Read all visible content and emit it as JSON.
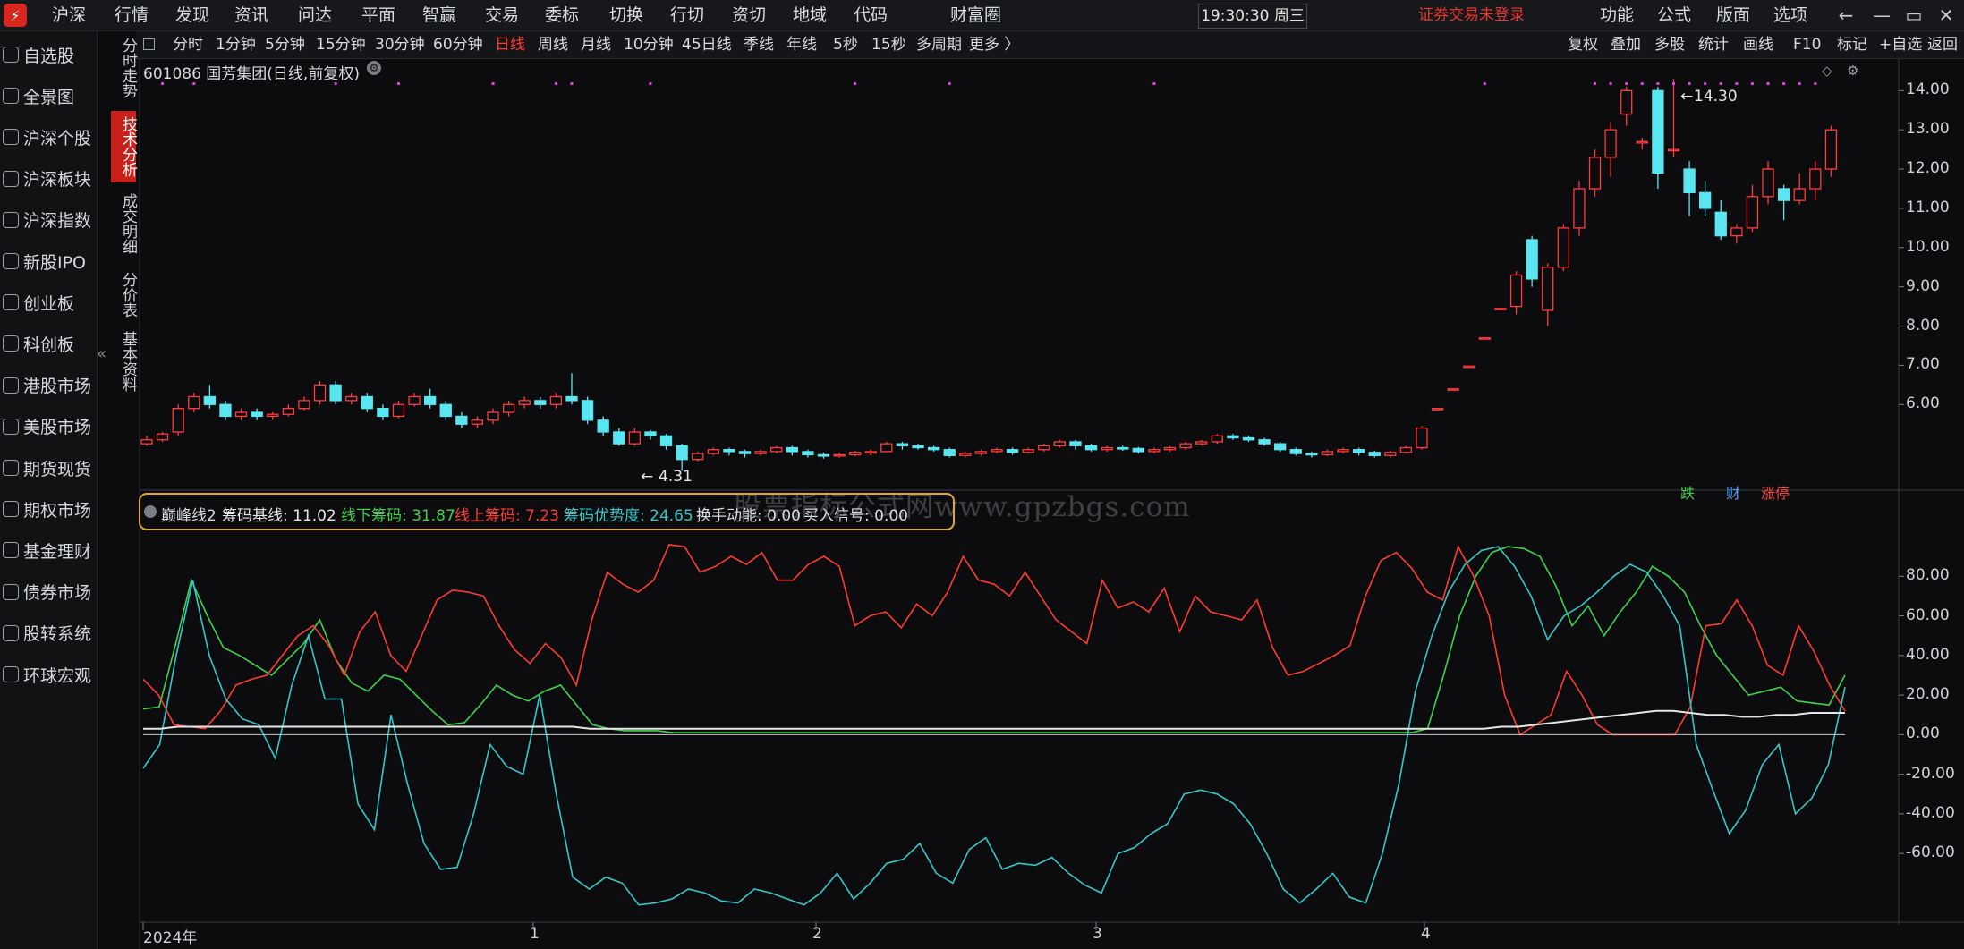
{
  "menu": [
    "沪深",
    "行情",
    "发现",
    "资讯",
    "问达",
    "平面",
    "智赢",
    "交易",
    "委标",
    "切换",
    "行切",
    "资切",
    "地域",
    "代码",
    "财富圈"
  ],
  "clock": "19:30:30 周三",
  "notice": "证券交易未登录",
  "right_menu": [
    "功能",
    "公式",
    "版面",
    "选项"
  ],
  "window_buttons": [
    "←",
    "—",
    "▭",
    "✕"
  ],
  "sidebar": [
    "自选股",
    "全景图",
    "沪深个股",
    "沪深板块",
    "沪深指数",
    "新股IPO",
    "创业板",
    "科创板",
    "港股市场",
    "美股市场",
    "期货现货",
    "期权市场",
    "基金理财",
    "债券市场",
    "股转系统",
    "环球宏观"
  ],
  "vtabs": [
    "分时走势",
    "技术分析",
    "成交明细",
    "分价表",
    "基本资料"
  ],
  "periods": [
    "分时",
    "1分钟",
    "5分钟",
    "15分钟",
    "30分钟",
    "60分钟",
    "日线",
    "周线",
    "月线",
    "10分钟",
    "45日线",
    "季线",
    "年线",
    "5秒",
    "15秒",
    "多周期",
    "更多 〉"
  ],
  "active_period": "日线",
  "tools": [
    "复权",
    "叠加",
    "多股",
    "统计",
    "画线",
    "F10",
    "标记",
    "+自选",
    "返回"
  ],
  "stock_title": "601086 国芳集团(日线,前复权)",
  "price_high_label": "14.30",
  "price_low_label": "4.31",
  "tags": {
    "die": "跌",
    "cai": "财",
    "zhangting": "涨停",
    "die_color": "#3cd24c",
    "cai_color": "#4aa3ff",
    "zhangting_color": "#ff4040"
  },
  "indicator_legend": [
    {
      "text": "巅峰线2",
      "color": "#d8dbe0"
    },
    {
      "text": "筹码基线: 11.02",
      "color": "#e6e6e6"
    },
    {
      "text": "线下筹码: 31.87",
      "color": "#3cd24c"
    },
    {
      "text": "线上筹码: 7.23",
      "color": "#ff3b30"
    },
    {
      "text": "筹码优势度: 24.65",
      "color": "#32c8c8"
    },
    {
      "text": "换手动能: 0.00",
      "color": "#d8dbe0"
    },
    {
      "text": "买入信号: 0.00",
      "color": "#d8dbe0"
    }
  ],
  "watermark": "股票指标公式网www.gpzbgs.com",
  "x_labels": [
    "2024年",
    "1",
    "2",
    "3",
    "4"
  ],
  "colors": {
    "up": "#ff3b3b",
    "down": "#5ae6f0",
    "accent": "#e1a82a"
  },
  "chart_data": [
    {
      "type": "candlestick",
      "title": "601086 国芳集团(日线,前复权)",
      "y_ticks": [
        6.0,
        7.0,
        8.0,
        9.0,
        10.0,
        11.0,
        12.0,
        13.0,
        14.0
      ],
      "ylim": [
        4.0,
        14.6
      ],
      "candles": [
        [
          5.0,
          5.1,
          4.95,
          5.2
        ],
        [
          5.1,
          5.25,
          5.05,
          5.3
        ],
        [
          5.3,
          5.9,
          5.2,
          6.0
        ],
        [
          5.9,
          6.2,
          5.8,
          6.3
        ],
        [
          6.2,
          6.0,
          5.9,
          6.5
        ],
        [
          6.0,
          5.7,
          5.6,
          6.1
        ],
        [
          5.7,
          5.8,
          5.6,
          5.9
        ],
        [
          5.8,
          5.7,
          5.6,
          5.9
        ],
        [
          5.7,
          5.75,
          5.6,
          5.8
        ],
        [
          5.75,
          5.9,
          5.7,
          6.0
        ],
        [
          5.9,
          6.1,
          5.85,
          6.2
        ],
        [
          6.1,
          6.5,
          6.0,
          6.6
        ],
        [
          6.5,
          6.1,
          6.0,
          6.6
        ],
        [
          6.1,
          6.2,
          6.0,
          6.3
        ],
        [
          6.2,
          5.9,
          5.8,
          6.3
        ],
        [
          5.9,
          5.7,
          5.6,
          6.0
        ],
        [
          5.7,
          6.0,
          5.65,
          6.1
        ],
        [
          6.0,
          6.2,
          5.95,
          6.3
        ],
        [
          6.2,
          6.0,
          5.9,
          6.4
        ],
        [
          6.0,
          5.7,
          5.6,
          6.1
        ],
        [
          5.7,
          5.5,
          5.4,
          5.8
        ],
        [
          5.5,
          5.6,
          5.4,
          5.7
        ],
        [
          5.6,
          5.8,
          5.5,
          5.9
        ],
        [
          5.8,
          6.0,
          5.7,
          6.1
        ],
        [
          6.0,
          6.1,
          5.9,
          6.2
        ],
        [
          6.1,
          6.0,
          5.9,
          6.2
        ],
        [
          6.0,
          6.2,
          5.9,
          6.3
        ],
        [
          6.2,
          6.1,
          6.0,
          6.8
        ],
        [
          6.1,
          5.6,
          5.5,
          6.2
        ],
        [
          5.6,
          5.3,
          5.2,
          5.7
        ],
        [
          5.3,
          5.0,
          4.95,
          5.4
        ],
        [
          5.0,
          5.3,
          4.95,
          5.4
        ],
        [
          5.3,
          5.2,
          5.1,
          5.35
        ],
        [
          5.2,
          4.95,
          4.85,
          5.25
        ],
        [
          4.95,
          4.6,
          4.31,
          5.0
        ],
        [
          4.6,
          4.75,
          4.55,
          4.8
        ],
        [
          4.75,
          4.85,
          4.7,
          4.9
        ],
        [
          4.85,
          4.8,
          4.7,
          4.9
        ],
        [
          4.8,
          4.75,
          4.65,
          4.85
        ],
        [
          4.75,
          4.8,
          4.7,
          4.85
        ],
        [
          4.8,
          4.9,
          4.75,
          4.95
        ],
        [
          4.9,
          4.8,
          4.7,
          4.95
        ],
        [
          4.8,
          4.72,
          4.65,
          4.85
        ],
        [
          4.72,
          4.7,
          4.62,
          4.78
        ],
        [
          4.7,
          4.72,
          4.65,
          4.78
        ],
        [
          4.72,
          4.78,
          4.68,
          4.82
        ],
        [
          4.78,
          4.8,
          4.7,
          4.85
        ],
        [
          4.8,
          5.0,
          4.78,
          5.05
        ],
        [
          5.0,
          4.95,
          4.85,
          5.05
        ],
        [
          4.95,
          4.9,
          4.85,
          5.0
        ],
        [
          4.9,
          4.85,
          4.8,
          4.95
        ],
        [
          4.85,
          4.7,
          4.65,
          4.9
        ],
        [
          4.7,
          4.75,
          4.65,
          4.8
        ],
        [
          4.75,
          4.8,
          4.7,
          4.85
        ],
        [
          4.8,
          4.85,
          4.75,
          4.9
        ],
        [
          4.85,
          4.78,
          4.72,
          4.9
        ],
        [
          4.78,
          4.85,
          4.75,
          4.9
        ],
        [
          4.85,
          4.95,
          4.8,
          5.0
        ],
        [
          4.95,
          5.05,
          4.9,
          5.1
        ],
        [
          5.05,
          4.95,
          4.85,
          5.1
        ],
        [
          4.95,
          4.85,
          4.8,
          5.0
        ],
        [
          4.85,
          4.9,
          4.8,
          4.95
        ],
        [
          4.9,
          4.88,
          4.82,
          4.95
        ],
        [
          4.88,
          4.8,
          4.75,
          4.92
        ],
        [
          4.8,
          4.85,
          4.75,
          4.9
        ],
        [
          4.85,
          4.9,
          4.8,
          4.95
        ],
        [
          4.9,
          5.0,
          4.85,
          5.05
        ],
        [
          5.0,
          5.05,
          4.95,
          5.1
        ],
        [
          5.05,
          5.2,
          5.0,
          5.25
        ],
        [
          5.2,
          5.15,
          5.1,
          5.25
        ],
        [
          5.15,
          5.1,
          5.05,
          5.2
        ],
        [
          5.1,
          5.0,
          4.95,
          5.15
        ],
        [
          5.0,
          4.85,
          4.8,
          5.05
        ],
        [
          4.85,
          4.75,
          4.7,
          4.9
        ],
        [
          4.75,
          4.72,
          4.65,
          4.8
        ],
        [
          4.72,
          4.8,
          4.68,
          4.85
        ],
        [
          4.8,
          4.85,
          4.75,
          4.9
        ],
        [
          4.85,
          4.78,
          4.7,
          4.9
        ],
        [
          4.78,
          4.7,
          4.65,
          4.82
        ],
        [
          4.7,
          4.78,
          4.65,
          4.82
        ],
        [
          4.78,
          4.9,
          4.75,
          4.95
        ],
        [
          4.9,
          5.4,
          4.85,
          5.45
        ],
        [
          5.9,
          5.9,
          5.9,
          5.9
        ],
        [
          6.4,
          6.4,
          6.4,
          6.4
        ],
        [
          6.98,
          6.98,
          6.98,
          6.98
        ],
        [
          7.7,
          7.7,
          7.7,
          7.7
        ],
        [
          8.45,
          8.45,
          8.45,
          8.45
        ],
        [
          8.5,
          9.3,
          8.3,
          9.4
        ],
        [
          10.2,
          9.2,
          9.0,
          10.3
        ],
        [
          8.4,
          9.5,
          8.0,
          9.6
        ],
        [
          9.5,
          10.5,
          9.4,
          10.6
        ],
        [
          10.5,
          11.5,
          10.3,
          11.7
        ],
        [
          11.5,
          12.3,
          11.3,
          12.5
        ],
        [
          12.3,
          13.0,
          11.8,
          13.2
        ],
        [
          13.4,
          14.0,
          13.1,
          14.1
        ],
        [
          12.7,
          12.7,
          12.5,
          12.8
        ],
        [
          14.0,
          11.9,
          11.5,
          14.1
        ],
        [
          12.5,
          12.5,
          12.3,
          14.3
        ],
        [
          12.0,
          11.4,
          10.8,
          12.2
        ],
        [
          11.4,
          11.0,
          10.8,
          11.7
        ],
        [
          10.9,
          10.3,
          10.2,
          11.2
        ],
        [
          10.3,
          10.5,
          10.1,
          10.6
        ],
        [
          10.5,
          11.3,
          10.4,
          11.6
        ],
        [
          11.3,
          12.0,
          11.1,
          12.2
        ],
        [
          11.5,
          11.2,
          10.7,
          11.6
        ],
        [
          11.2,
          11.5,
          11.1,
          11.9
        ],
        [
          11.5,
          12.0,
          11.2,
          12.2
        ],
        [
          12.0,
          13.0,
          11.8,
          13.1
        ]
      ]
    },
    {
      "type": "line",
      "title": "巅峰线2",
      "y_ticks": [
        -60.0,
        -40.0,
        -20.0,
        0.0,
        20.0,
        40.0,
        60.0,
        80.0
      ],
      "ylim": [
        -92,
        100
      ],
      "series": [
        {
          "name": "线下筹码",
          "color": "#3cd24c",
          "values": [
            13,
            14,
            45,
            78,
            60,
            44,
            40,
            35,
            30,
            38,
            46,
            58,
            38,
            26,
            22,
            30,
            28,
            20,
            12,
            5,
            6,
            15,
            25,
            20,
            17,
            22,
            25,
            15,
            5,
            3,
            2,
            2,
            2,
            1,
            1,
            1,
            1,
            1,
            1,
            1,
            1,
            1,
            1,
            1,
            1,
            1,
            1,
            1,
            1,
            1,
            1,
            1,
            1,
            1,
            1,
            1,
            1,
            1,
            1,
            1,
            1,
            1,
            1,
            1,
            1,
            1,
            1,
            1,
            1,
            1,
            1,
            1,
            1,
            1,
            1,
            1,
            1,
            1,
            1,
            1,
            3,
            30,
            60,
            80,
            92,
            95,
            94,
            90,
            75,
            55,
            65,
            50,
            62,
            72,
            85,
            80,
            72,
            55,
            40,
            30,
            20,
            22,
            24,
            17,
            16,
            15,
            30
          ]
        },
        {
          "name": "线上筹码",
          "color": "#ff3b30",
          "values": [
            28,
            20,
            5,
            4,
            3,
            12,
            25,
            28,
            30,
            40,
            50,
            55,
            45,
            30,
            52,
            62,
            40,
            32,
            50,
            68,
            73,
            72,
            70,
            55,
            43,
            36,
            46,
            39,
            25,
            58,
            82,
            76,
            72,
            78,
            96,
            95,
            82,
            85,
            90,
            86,
            92,
            78,
            78,
            86,
            90,
            85,
            55,
            60,
            62,
            54,
            66,
            60,
            72,
            90,
            78,
            76,
            70,
            82,
            70,
            58,
            52,
            46,
            78,
            64,
            67,
            62,
            74,
            52,
            70,
            62,
            60,
            58,
            68,
            44,
            30,
            32,
            36,
            40,
            45,
            70,
            88,
            92,
            84,
            72,
            68,
            95,
            80,
            60,
            20,
            0,
            5,
            10,
            32,
            20,
            5,
            0,
            0,
            0,
            0,
            0,
            14,
            55,
            56,
            68,
            55,
            35,
            30,
            55,
            42,
            25,
            12
          ]
        },
        {
          "name": "筹码优势度",
          "color": "#32c8c8",
          "values": [
            -17,
            -5,
            40,
            78,
            40,
            18,
            8,
            5,
            -12,
            25,
            50,
            18,
            18,
            -35,
            -48,
            10,
            -25,
            -55,
            -68,
            -67,
            -40,
            -5,
            -16,
            -20,
            20,
            -30,
            -72,
            -78,
            -72,
            -75,
            -86,
            -85,
            -83,
            -78,
            -80,
            -84,
            -85,
            -78,
            -80,
            -83,
            -86,
            -80,
            -70,
            -83,
            -75,
            -65,
            -63,
            -55,
            -70,
            -75,
            -58,
            -52,
            -68,
            -65,
            -66,
            -62,
            -70,
            -76,
            -80,
            -60,
            -57,
            -50,
            -45,
            -30,
            -28,
            -30,
            -35,
            -45,
            -60,
            -78,
            -85,
            -78,
            -70,
            -82,
            -85,
            -60,
            -25,
            22,
            50,
            72,
            86,
            93,
            95,
            85,
            70,
            48,
            60,
            65,
            72,
            80,
            86,
            82,
            70,
            55,
            -5,
            -28,
            -50,
            -38,
            -15,
            -5,
            -40,
            -32,
            -15,
            24
          ]
        },
        {
          "name": "筹码基线",
          "color": "#e6e6e6",
          "values": [
            3,
            3,
            4,
            4,
            4,
            4,
            4,
            4,
            4,
            4,
            4,
            4,
            4,
            4,
            4,
            4,
            4,
            4,
            4,
            4,
            4,
            4,
            4,
            4,
            4,
            4,
            3,
            3,
            3,
            3,
            3,
            3,
            3,
            3,
            3,
            3,
            3,
            3,
            3,
            3,
            3,
            3,
            3,
            3,
            3,
            3,
            3,
            3,
            3,
            3,
            3,
            3,
            3,
            3,
            3,
            3,
            3,
            3,
            3,
            3,
            3,
            3,
            3,
            3,
            3,
            3,
            3,
            3,
            3,
            3,
            3,
            3,
            3,
            3,
            3,
            3,
            3,
            3,
            3,
            4,
            4,
            5,
            6,
            7,
            8,
            9,
            10,
            11,
            12,
            12,
            11,
            10,
            10,
            9,
            9,
            10,
            10,
            11,
            11,
            11
          ]
        }
      ]
    }
  ]
}
